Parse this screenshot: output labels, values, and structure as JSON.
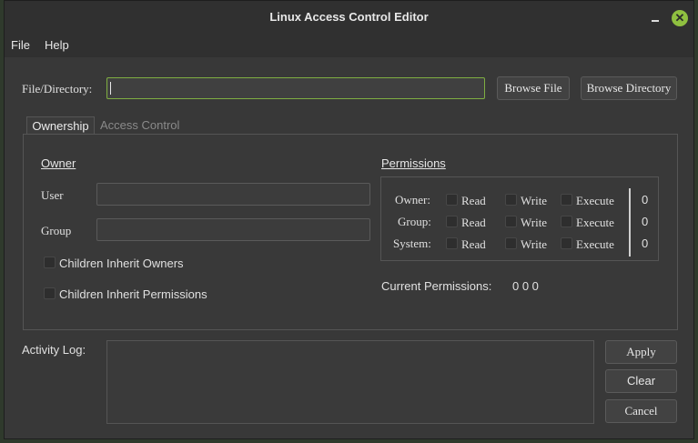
{
  "window": {
    "title": "Linux Access Control Editor"
  },
  "menu": {
    "file": "File",
    "help": "Help"
  },
  "path": {
    "label": "File/Directory:",
    "value": "",
    "browse_file": "Browse File",
    "browse_directory": "Browse Directory"
  },
  "tabs": [
    {
      "label": "Ownership",
      "active": true
    },
    {
      "label": "Access Control",
      "active": false
    }
  ],
  "owner": {
    "heading": "Owner",
    "user_label": "User",
    "user_value": "",
    "group_label": "Group",
    "group_value": "",
    "inherit_owners": "Children Inherit Owners",
    "inherit_permissions": "Children Inherit Permissions"
  },
  "permissions": {
    "heading": "Permissions",
    "rows": [
      {
        "label": "Owner:",
        "read": "Read",
        "write": "Write",
        "execute": "Execute",
        "value": "0"
      },
      {
        "label": "Group:",
        "read": "Read",
        "write": "Write",
        "execute": "Execute",
        "value": "0"
      },
      {
        "label": "System:",
        "read": "Read",
        "write": "Write",
        "execute": "Execute",
        "value": "0"
      }
    ],
    "current_label": "Current Permissions:",
    "current_value": "0 0 0"
  },
  "log": {
    "label": "Activity Log:",
    "value": ""
  },
  "actions": {
    "apply": "Apply",
    "clear": "Clear",
    "cancel": "Cancel"
  },
  "colors": {
    "accent": "#8fc040",
    "window_bg": "#383838"
  }
}
